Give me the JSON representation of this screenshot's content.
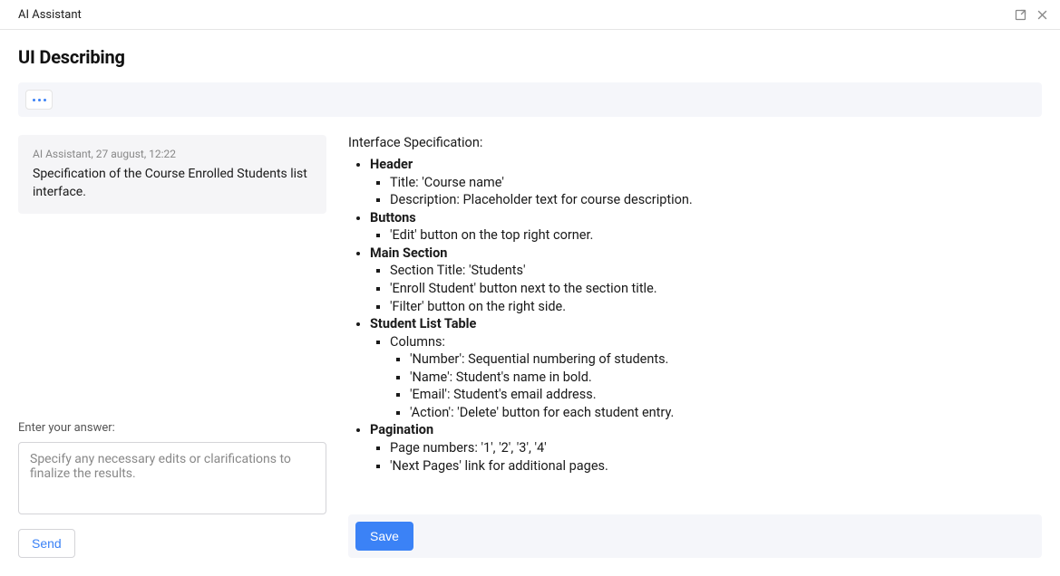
{
  "titlebar": {
    "title": "AI Assistant"
  },
  "page": {
    "title": "UI Describing"
  },
  "message": {
    "meta": "AI Assistant, 27 august, 12:22",
    "body": "Specification of the Course Enrolled Students list interface."
  },
  "answer": {
    "label": "Enter your answer:",
    "placeholder": "Specify any necessary edits or clarifications to finalize the results.",
    "send": "Send"
  },
  "spec": {
    "title": "Interface Specification:",
    "sections": {
      "header": {
        "label": "Header",
        "items": [
          "Title: 'Course name'",
          "Description: Placeholder text for course description."
        ]
      },
      "buttons": {
        "label": "Buttons",
        "items": [
          "'Edit' button on the top right corner."
        ]
      },
      "main": {
        "label": "Main Section",
        "items": [
          "Section Title: 'Students'",
          "'Enroll Student' button next to the section title.",
          "'Filter' button on the right side."
        ]
      },
      "table": {
        "label": "Student List Table",
        "columns_label": "Columns:",
        "columns": [
          "'Number': Sequential numbering of students.",
          "'Name': Student's name in bold.",
          "'Email': Student's email address.",
          "'Action': 'Delete' button for each student entry."
        ]
      },
      "pagination": {
        "label": "Pagination",
        "items": [
          "Page numbers: '1', '2', '3', '4'",
          "'Next Pages' link for additional pages."
        ]
      }
    }
  },
  "actions": {
    "save": "Save"
  }
}
